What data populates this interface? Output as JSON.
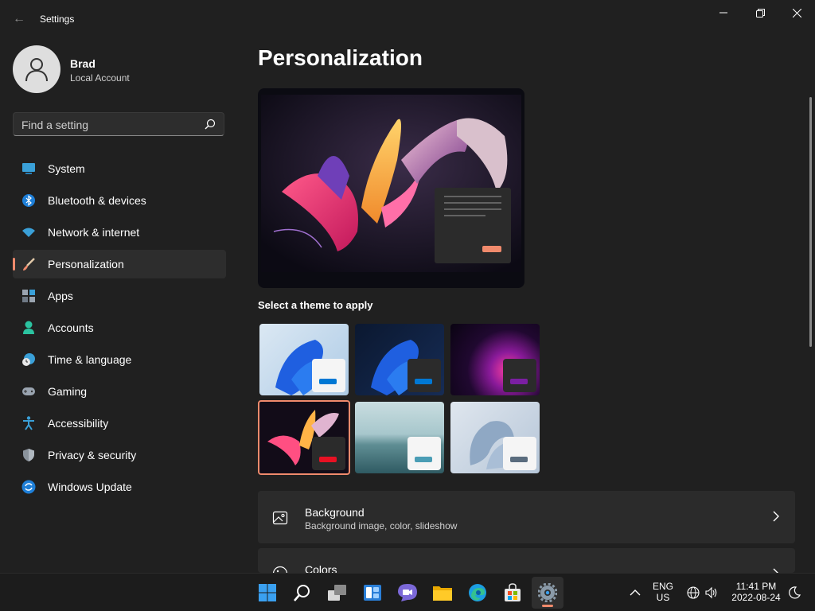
{
  "window": {
    "title": "Settings",
    "back_glyph": "←",
    "controls": [
      "minimize-icon",
      "restore-icon",
      "close-icon"
    ]
  },
  "user": {
    "name": "Brad",
    "account_type": "Local Account"
  },
  "search": {
    "placeholder": "Find a setting"
  },
  "sidebar": {
    "items": [
      {
        "label": "System",
        "icon": "system-icon"
      },
      {
        "label": "Bluetooth & devices",
        "icon": "bluetooth-icon"
      },
      {
        "label": "Network & internet",
        "icon": "wifi-icon"
      },
      {
        "label": "Personalization",
        "icon": "brush-icon",
        "active": true
      },
      {
        "label": "Apps",
        "icon": "apps-icon"
      },
      {
        "label": "Accounts",
        "icon": "accounts-icon"
      },
      {
        "label": "Time & language",
        "icon": "clock-globe-icon"
      },
      {
        "label": "Gaming",
        "icon": "gamepad-icon"
      },
      {
        "label": "Accessibility",
        "icon": "accessibility-icon"
      },
      {
        "label": "Privacy & security",
        "icon": "shield-icon"
      },
      {
        "label": "Windows Update",
        "icon": "update-icon"
      }
    ]
  },
  "main": {
    "title": "Personalization",
    "theme_heading": "Select a theme to apply",
    "themes": [
      {
        "name": "light-bloom",
        "accent": "#0078d4",
        "selected": false
      },
      {
        "name": "dark-bloom",
        "accent": "#0078d4",
        "selected": false
      },
      {
        "name": "glow",
        "accent": "#7b1fa2",
        "selected": false
      },
      {
        "name": "captured-motion",
        "accent": "#e81123",
        "selected": true
      },
      {
        "name": "sunrise",
        "accent": "#4a9db5",
        "selected": false
      },
      {
        "name": "flow",
        "accent": "#5a6c7e",
        "selected": false
      }
    ],
    "cards": [
      {
        "title": "Background",
        "subtitle": "Background image, color, slideshow",
        "icon": "image-icon"
      },
      {
        "title": "Colors",
        "subtitle": "",
        "icon": "palette-icon"
      }
    ]
  },
  "taskbar": {
    "apps": [
      "start-icon",
      "search-icon",
      "task-view-icon",
      "widgets-icon",
      "chat-icon",
      "file-explorer-icon",
      "edge-icon",
      "store-icon",
      "settings-icon"
    ],
    "active_app": "settings-icon",
    "language_top": "ENG",
    "language_bottom": "US",
    "time": "11:41 PM",
    "date": "2022-08-24"
  },
  "colors": {
    "accent": "#f08a6c",
    "background": "#202020",
    "card": "#2b2b2b"
  }
}
